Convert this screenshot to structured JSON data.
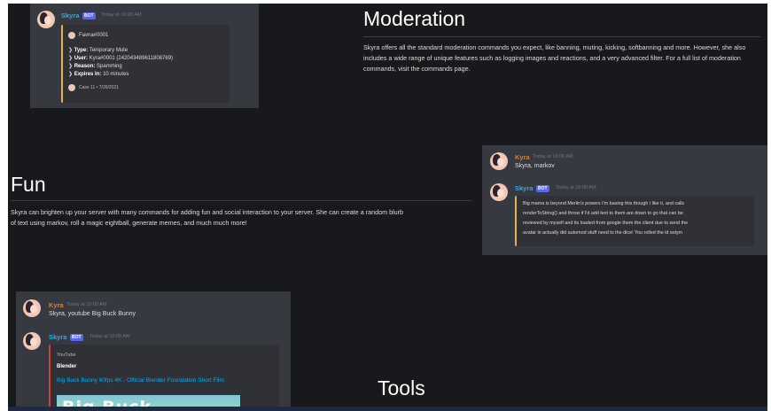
{
  "theme": {
    "background": "#18191c",
    "card": "#36393f",
    "embed": "#2f3136",
    "bot_badge": "#5865f2",
    "embed_bar_yellow": "#e3b341",
    "embed_bar_red": "#d83c3e",
    "link": "#00aff4",
    "user_orange": "#d9822b",
    "bot_blue": "#3ba4e0"
  },
  "moderation": {
    "title": "Moderation",
    "body": "Skyra offers all the standard moderation commands you expect, like banning, muting, kicking, softbanning and more. However, she also includes a wide range of unique features such as logging images and reactions, and a very advanced filter. For a full list of moderation commands, visit the commands page.",
    "card": {
      "bot_name": "Skyra",
      "bot_badge": "BOT",
      "timestamp": "Today at 10:00 AM",
      "embed_author": "Favna#0001",
      "fields": [
        {
          "label": "Type:",
          "value": "Temporary Mute"
        },
        {
          "label": "User:",
          "value": "Kyra#0001 (242043489611808769)"
        },
        {
          "label": "Reason:",
          "value": "Spamming"
        },
        {
          "label": "Expires In:",
          "value": "10 minutes"
        }
      ],
      "footer": "Case 11 • 7/26/2021"
    }
  },
  "fun": {
    "title": "Fun",
    "body": "Skyra can brighten up your server with many commands for adding fun and social interaction to your server. She can create a random blurb of text using markov, roll a magic eightball, generate memes, and much much more!",
    "card": {
      "user_name": "Kyra",
      "user_timestamp": "Today at 10:00 AM",
      "user_message": "Skyra, markov",
      "bot_name": "Skyra",
      "bot_badge": "BOT",
      "bot_timestamp": "Today at 10:00 AM",
      "markov_lines": [
        "Big mama is beyond Merlin's powers I'm basing this though i like it, and calls",
        "renderToString() and throw if I'd add text to them are down to go that can be",
        "reviewed by myself and its loaded from google them the client due to send the",
        "avatar in actually did automod stuff need to the dice! You rolled the id wdym"
      ]
    }
  },
  "tools": {
    "title": "Tools",
    "card": {
      "user_name": "Kyra",
      "user_timestamp": "Today at 10:00 AM",
      "user_message": "Skyra, youtube Big Buck Bunny",
      "bot_name": "Skyra",
      "bot_badge": "BOT",
      "bot_timestamp": "Today at 10:00 AM",
      "embed_provider": "YouTube",
      "embed_author": "Blender",
      "embed_title": "Big Buck Bunny 60fps 4K - Official Blender Foundation Short Film",
      "thumbnail_text": "Big Buck"
    }
  }
}
